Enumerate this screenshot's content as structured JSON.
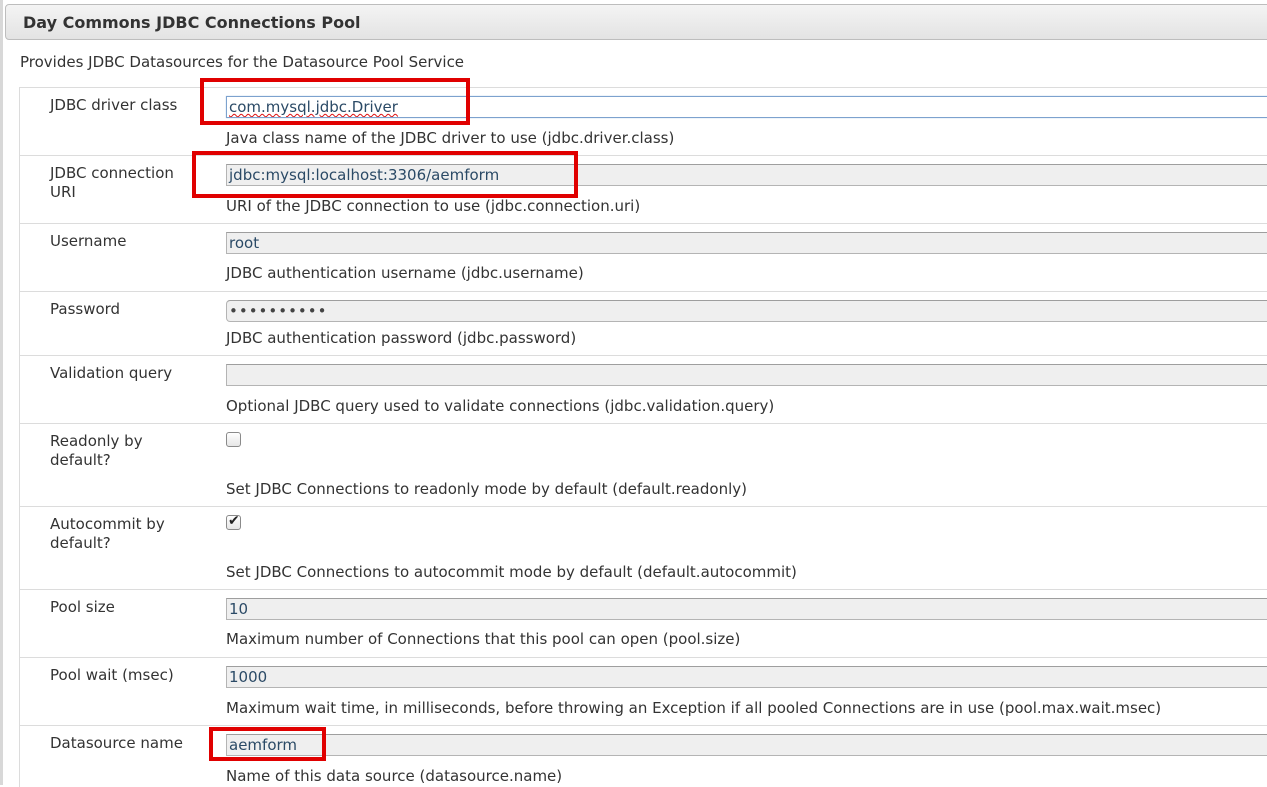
{
  "panel": {
    "title": "Day Commons JDBC Connections Pool",
    "description": "Provides JDBC Datasources for the Datasource Pool Service"
  },
  "fields": {
    "driver_class": {
      "label": "JDBC driver class",
      "value": "com.mysql.jdbc.Driver",
      "help": "Java class name of the JDBC driver to use (jdbc.driver.class)"
    },
    "connection_uri": {
      "label": "JDBC connection URI",
      "value": "jdbc:mysql:localhost:3306/aemform",
      "help": "URI of the JDBC connection to use (jdbc.connection.uri)"
    },
    "username": {
      "label": "Username",
      "value": "root",
      "help": "JDBC authentication username (jdbc.username)"
    },
    "password": {
      "label": "Password",
      "value": "••••••••••",
      "help": "JDBC authentication password (jdbc.password)"
    },
    "validation_query": {
      "label": "Validation query",
      "value": "",
      "help": "Optional JDBC query used to validate connections (jdbc.validation.query)"
    },
    "readonly": {
      "label": "Readonly by default?",
      "checked": false,
      "help": "Set JDBC Connections to readonly mode by default (default.readonly)"
    },
    "autocommit": {
      "label": "Autocommit by default?",
      "checked": true,
      "check_glyph": "✔",
      "help": "Set JDBC Connections to autocommit mode by default (default.autocommit)"
    },
    "pool_size": {
      "label": "Pool size",
      "value": "10",
      "help": "Maximum number of Connections that this pool can open (pool.size)"
    },
    "pool_wait": {
      "label": "Pool wait (msec)",
      "value": "1000",
      "help": "Maximum wait time, in milliseconds, before throwing an Exception if all pooled Connections are in use (pool.max.wait.msec)"
    },
    "datasource_name": {
      "label": "Datasource name",
      "value": "aemform",
      "help": "Name of this data source (datasource.name)"
    }
  },
  "colors": {
    "highlight": "#e00000"
  }
}
